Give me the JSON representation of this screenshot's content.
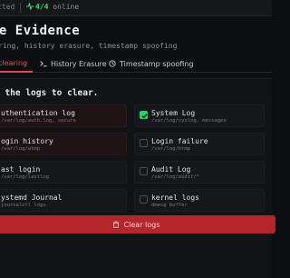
{
  "status_bar": {
    "connection_text": "cted",
    "online_count": "4/4",
    "online_label": "online"
  },
  "header": {
    "title": "se Evidence",
    "subtitle": "ring, history erasure, timestamp spoofing"
  },
  "tabs": [
    {
      "label": "clearing",
      "icon": "broom-icon",
      "active": true
    },
    {
      "label": "History Erasure",
      "icon": "terminal-icon",
      "active": false
    },
    {
      "label": "Timestamp spoofing",
      "icon": "clock-icon",
      "active": false
    }
  ],
  "section": {
    "heading": "t the logs to clear."
  },
  "logs": [
    {
      "name": "uthentication log",
      "path": "/var/log/auth.log, secure",
      "checked": false,
      "danger": true
    },
    {
      "name": "System Log",
      "path": "/var/log/syslog, messages",
      "checked": true,
      "danger": false
    },
    {
      "name": "ogin history",
      "path": "/var/log/wtmp",
      "checked": false,
      "danger": true
    },
    {
      "name": "Login failure",
      "path": "/var/log/btmp",
      "checked": false,
      "danger": false
    },
    {
      "name": "ast login",
      "path": "/var/log/lastlog",
      "checked": false,
      "danger": false
    },
    {
      "name": "Audit Log",
      "path": "/var/log/audit/*",
      "checked": false,
      "danger": false
    },
    {
      "name": "ystemd Journal",
      "path": "journalctl logs",
      "checked": false,
      "danger": false
    },
    {
      "name": "kernel logs",
      "path": "dmesg buffer",
      "checked": false,
      "danger": false
    }
  ],
  "clear_button": {
    "label": "Clear logs",
    "icon": "trash-icon"
  },
  "colors": {
    "accent": "#e74848",
    "online": "#3ddc6a",
    "checked": "#2ecc71",
    "button": "#b4252c"
  }
}
